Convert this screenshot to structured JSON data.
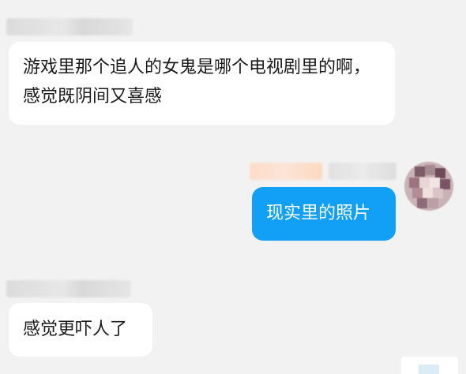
{
  "chat": {
    "messages": [
      {
        "side": "left",
        "text": "游戏里那个追人的女鬼是哪个电视剧里的啊，感觉既阴间又喜感"
      },
      {
        "side": "right",
        "text": "现实里的照片"
      },
      {
        "side": "left",
        "text": "感觉更吓人了"
      }
    ]
  },
  "colors": {
    "background": "#f2f2f2",
    "incoming_bubble": "#ffffff",
    "outgoing_bubble": "#12a0f6",
    "outgoing_text": "#ffffff",
    "name_tag_orange": "#ffd9c2"
  },
  "icons": {
    "avatar": "avatar-icon",
    "corner": "corner-icon"
  }
}
